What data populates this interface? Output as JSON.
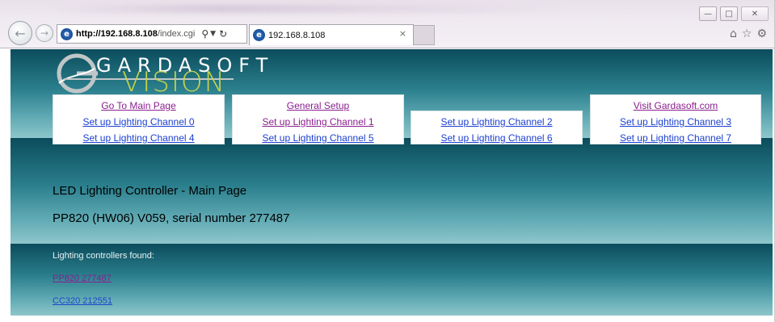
{
  "browser": {
    "address_url_host": "http://192.168.8.108",
    "address_url_path": "/index.cgi",
    "tab_title": "192.168.8.108",
    "tab_close_glyph": "×",
    "window_controls": [
      "minimize-icon",
      "maximize-icon",
      "close-icon"
    ],
    "right_icons": [
      "home-icon",
      "favorites-star-icon",
      "settings-gear-icon"
    ],
    "nav_icons": [
      "back-arrow-icon",
      "forward-arrow-icon"
    ]
  },
  "logo": {
    "word1": "GARDASOFT",
    "word2": "VISION"
  },
  "nav": {
    "box1": [
      "Go To Main Page",
      "Set up Lighting Channel 0",
      "Set up Lighting Channel 4"
    ],
    "box2": [
      "General Setup",
      "Set up Lighting Channel 1",
      "Set up Lighting Channel 5"
    ],
    "box3": [
      "Set up Lighting Channel 2",
      "Set up Lighting Channel 6"
    ],
    "box4": [
      "Visit Gardasoft.com",
      "Set up Lighting Channel 3",
      "Set up Lighting Channel 7"
    ]
  },
  "main": {
    "title": "LED Lighting Controller - Main Page",
    "device_info": "PP820 (HW06) V059, serial number 277487"
  },
  "controllers": {
    "label": "Lighting controllers found:",
    "items": [
      "PP820 277487",
      "CC320 212551"
    ]
  },
  "colors": {
    "link_blue": "#1b3fd0",
    "link_visited": "#8a1f8e",
    "band_dark": "#0b4c5c",
    "band_light": "#8ec6cb",
    "logo_green": "#c6d44a"
  }
}
